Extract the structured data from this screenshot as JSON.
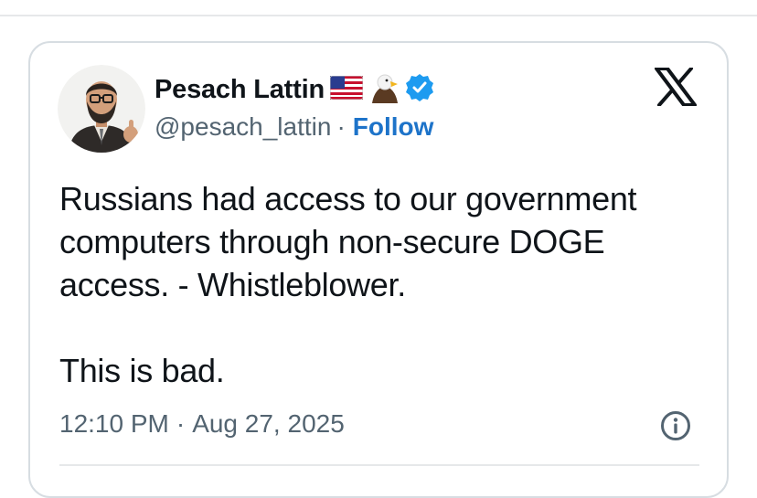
{
  "author": {
    "name": "Pesach Lattin",
    "handle": "@pesach_lattin",
    "separator": "·",
    "follow_label": "Follow"
  },
  "icons": {
    "flag": "us-flag-icon",
    "eagle": "eagle-icon",
    "verified": "verified-badge-icon",
    "platform": "x-logo-icon",
    "info": "info-icon"
  },
  "tweet": {
    "line1": "Russians had access to our government",
    "line2": "computers through non-secure DOGE",
    "line3": "access. - Whistleblower.",
    "line4": "This is bad."
  },
  "meta": {
    "time": "12:10 PM",
    "separator": "·",
    "date": "Aug 27, 2025"
  },
  "colors": {
    "text": "#0f1419",
    "secondary": "#536471",
    "link": "#1d73c9",
    "verified": "#1d9bf0",
    "border": "#d7dde2"
  }
}
